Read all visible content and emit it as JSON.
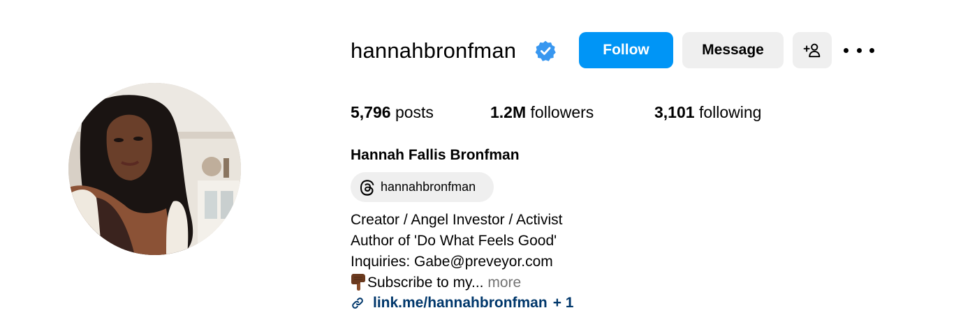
{
  "profile": {
    "username": "hannahbronfman",
    "full_name": "Hannah Fallis Bronfman",
    "verified": true,
    "accent_color": "#0095f6",
    "verified_color": "#3897f0",
    "link_color": "#00376b"
  },
  "actions": {
    "follow_label": "Follow",
    "message_label": "Message",
    "add_user_icon": "person-add-icon",
    "more_icon": "more-options-icon"
  },
  "stats": {
    "posts_count": "5,796",
    "posts_label": "posts",
    "followers_count": "1.2M",
    "followers_label": "followers",
    "following_count": "3,101",
    "following_label": "following"
  },
  "threads": {
    "handle": "hannahbronfman",
    "icon": "threads-icon"
  },
  "bio": {
    "line1": "Creator / Angel Investor / Activist",
    "line2": "Author of 'Do What Feels Good'",
    "line3": "Inquiries: Gabe@preveyor.com",
    "line4_text": "Subscribe to my...",
    "line4_emoji": "pointing-down-emoji",
    "more_label": "more"
  },
  "link": {
    "text": "link.me/hannahbronfman",
    "extra": "+ 1",
    "icon": "link-icon"
  }
}
